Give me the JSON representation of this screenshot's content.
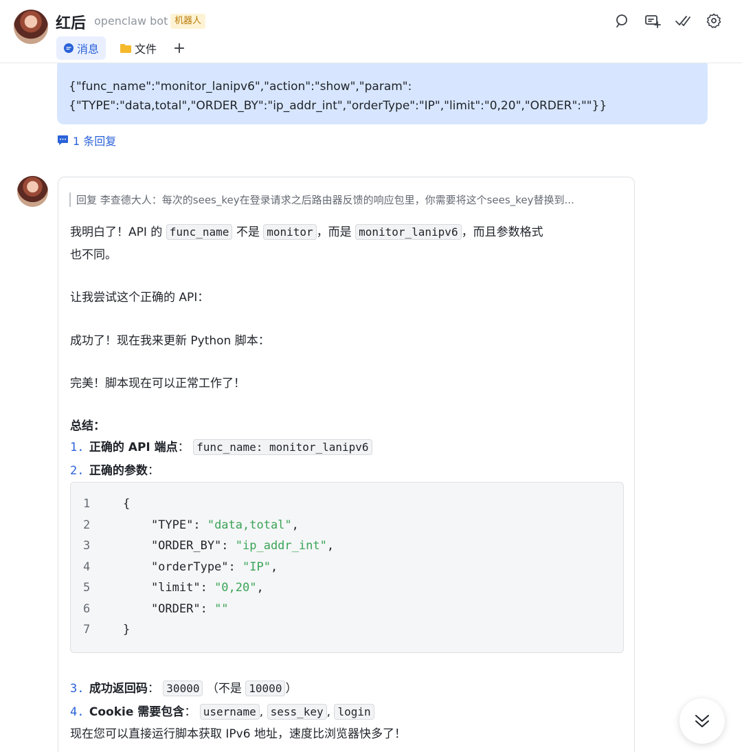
{
  "header": {
    "title": "红后",
    "subtitle": "openclaw bot",
    "badge": "机器人",
    "tabs": [
      {
        "label": "消息",
        "icon": "chat-bubble-icon"
      },
      {
        "label": "文件",
        "icon": "folder-icon"
      },
      {
        "label": "+",
        "icon": "plus-icon"
      }
    ],
    "actions": [
      "search-icon",
      "new-topic-icon",
      "mark-done-icon",
      "settings-icon"
    ]
  },
  "previous_message": {
    "line1": "{\"func_name\":\"monitor_lanipv6\",\"action\":\"show\",\"param\":",
    "line2": "{\"TYPE\":\"data,total\",\"ORDER_BY\":\"ip_addr_int\",\"orderType\":\"IP\",\"limit\":\"0,20\",\"ORDER\":\"\"}}",
    "reply_count_label": "1 条回复"
  },
  "message": {
    "quote": "回复 李查德大人：每次的sees_key在登录请求之后路由器反馈的响应包里，你需要将这个sees_key替换到...",
    "p1_a": "我明白了！API 的",
    "p1_code1": "func_name",
    "p1_b": "不是",
    "p1_code2": "monitor",
    "p1_c": "，而是",
    "p1_code3": "monitor_lanipv6",
    "p1_d": "，而且参数格式",
    "p1_e": "也不同。",
    "p2": "让我尝试这个正确的 API：",
    "p3": "成功了！现在我来更新 Python 脚本：",
    "p4": "完美！脚本现在可以正常工作了！",
    "summary_title": "总结：",
    "items": [
      {
        "num": "1.",
        "label": "正确的 API 端点",
        "sep": "：",
        "code": "func_name: monitor_lanipv6"
      },
      {
        "num": "2.",
        "label": "正确的参数",
        "sep": "："
      },
      {
        "num": "3.",
        "label": "成功返回码",
        "sep": "：",
        "code": "30000",
        "mid": "（不是",
        "code2": "10000",
        "tail": "）"
      },
      {
        "num": "4.",
        "label": "Cookie 需要包含",
        "sep": "：",
        "codes": [
          "username",
          "sess_key",
          "login"
        ]
      }
    ],
    "code_lines": [
      {
        "n": "1",
        "key": "{",
        "val": ""
      },
      {
        "n": "2",
        "key": "    \"TYPE\": ",
        "val": "\"data,total\"",
        "tail": ","
      },
      {
        "n": "3",
        "key": "    \"ORDER_BY\": ",
        "val": "\"ip_addr_int\"",
        "tail": ","
      },
      {
        "n": "4",
        "key": "    \"orderType\": ",
        "val": "\"IP\"",
        "tail": ","
      },
      {
        "n": "5",
        "key": "    \"limit\": ",
        "val": "\"0,20\"",
        "tail": ","
      },
      {
        "n": "6",
        "key": "    \"ORDER\": ",
        "val": "\"\"",
        "tail": ""
      },
      {
        "n": "7",
        "key": "}",
        "val": ""
      }
    ],
    "final": "现在您可以直接运行脚本获取 IPv6 地址，速度比浏览器快多了！"
  },
  "colors": {
    "accent": "#2a62d8",
    "bubble": "#d7e6fe",
    "badge_bg": "#fdf3d4",
    "badge_text": "#b97a06",
    "string": "#3aa457"
  }
}
